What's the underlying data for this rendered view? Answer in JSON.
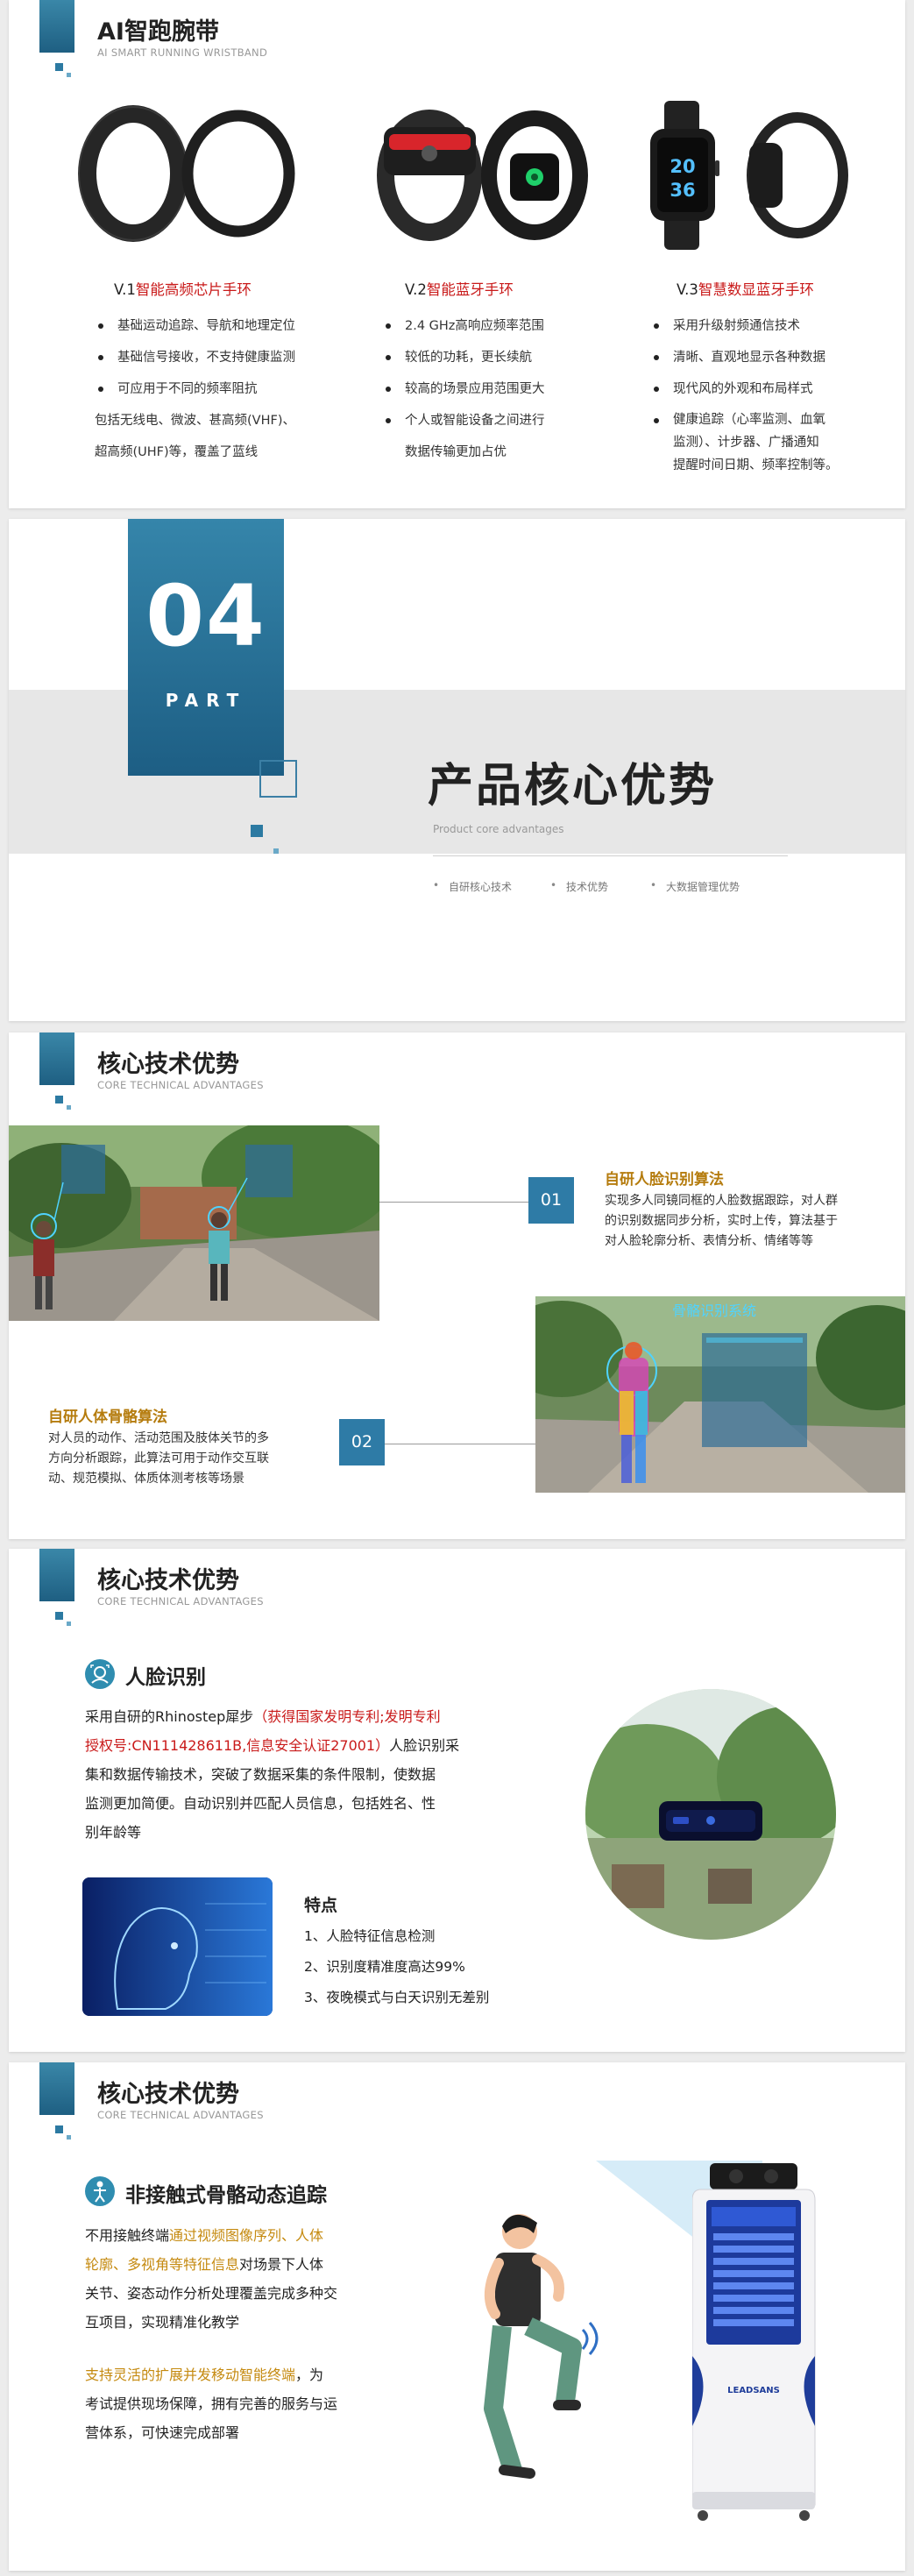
{
  "slide1": {
    "title": "AI智跑腕带",
    "subtitle": "AI SMART RUNNING WRISTBAND",
    "products": [
      {
        "version": "V.1",
        "name": "智能高频芯片手环",
        "bullets": [
          "基础运动追踪、导航和地理定位",
          "基础信号接收，不支持健康监测",
          "可应用于不同的频率阻抗"
        ],
        "extra": [
          "包括无线电、微波、甚高频(VHF)、",
          "超高频(UHF)等，覆盖了蓝线"
        ]
      },
      {
        "version": "V.2",
        "name": "智能蓝牙手环",
        "bullets": [
          "2.4 GHz高响应频率范围",
          "较低的功耗，更长续航",
          "较高的场景应用范围更大",
          "个人或智能设备之间进行"
        ],
        "extra": [
          "数据传输更加占优"
        ]
      },
      {
        "version": "V.3",
        "name": "智慧数显蓝牙手环",
        "bullets": [
          "采用升级射频通信技术",
          "清晰、直观地显示各种数据",
          "现代风的外观和布局样式"
        ],
        "multi": [
          "健康追踪（心率监测、血氧",
          "监测）、计步器、广播通知",
          "提醒时间日期、频率控制等。"
        ]
      }
    ],
    "watch_time_top": "20",
    "watch_time_bottom": "36"
  },
  "slide2": {
    "part_number": "04",
    "part_label": "PART",
    "title": "产品核心优势",
    "subtitle": "Product core advantages",
    "items": [
      "自研核心技术",
      "技术优势",
      "大数据管理优势"
    ]
  },
  "slide3": {
    "title": "核心技术优势",
    "subtitle": "CORE TECHNICAL ADVANTAGES",
    "feature1": {
      "number": "01",
      "title": "自研人脸识别算法",
      "lines": [
        "实现多人同镜同框的人脸数据跟踪，对人群",
        "的识别数据同步分析，实时上传，算法基于",
        "对人脸轮廓分析、表情分析、情绪等等"
      ]
    },
    "feature2": {
      "number": "02",
      "title": "自研人体骨骼算法",
      "lines": [
        "对人员的动作、活动范围及肢体关节的多",
        "方向分析跟踪，此算法可用于动作交互联",
        "动、规范模拟、体质体测考核等场景"
      ]
    },
    "skeleton_panel_title": "骨骼识别系统"
  },
  "slide4": {
    "title": "核心技术优势",
    "subtitle": "CORE TECHNICAL ADVANTAGES",
    "section_title": "人脸识别",
    "para": {
      "l1a": "采用自研的Rhinostep犀步",
      "l1b": "（获得国家发明专利;发明专利",
      "l2a": "授权号:CN111428611B,信息安全认证27001）",
      "l2b": "人脸识别采",
      "l3": "集和数据传输技术，突破了数据采集的条件限制，使数据",
      "l4": "监测更加简便。自动识别并匹配人员信息，包括姓名、性",
      "l5": "别年龄等"
    },
    "features_title": "特点",
    "features": [
      "1、人脸特征信息检测",
      "2、识别度精准度高达99%",
      "3、夜晚模式与白天识别无差别"
    ]
  },
  "slide5": {
    "title": "核心技术优势",
    "subtitle": "CORE TECHNICAL ADVANTAGES",
    "section_title": "非接触式骨骼动态追踪",
    "para1": {
      "l1a": "不用接触终端",
      "l1b": "通过视频图像序列、人体",
      "l2a": "轮廓、多视角等特征信息",
      "l2b": "对场景下人体",
      "l3": "关节、姿态动作分析处理覆盖完成多种交",
      "l4": "互项目，实现精准化教学"
    },
    "para2": {
      "l1a": "支持灵活的扩展并发移动智能终端",
      "l1b": "，为",
      "l2": "考试提供现场保障，拥有完善的服务与运",
      "l3": "营体系，可快速完成部署"
    },
    "kiosk_brand": "LEADSANS",
    "colors": {
      "accent": "#2e7ba6",
      "highlight_red": "#c91a1a",
      "highlight_gold": "#c58a10"
    }
  }
}
